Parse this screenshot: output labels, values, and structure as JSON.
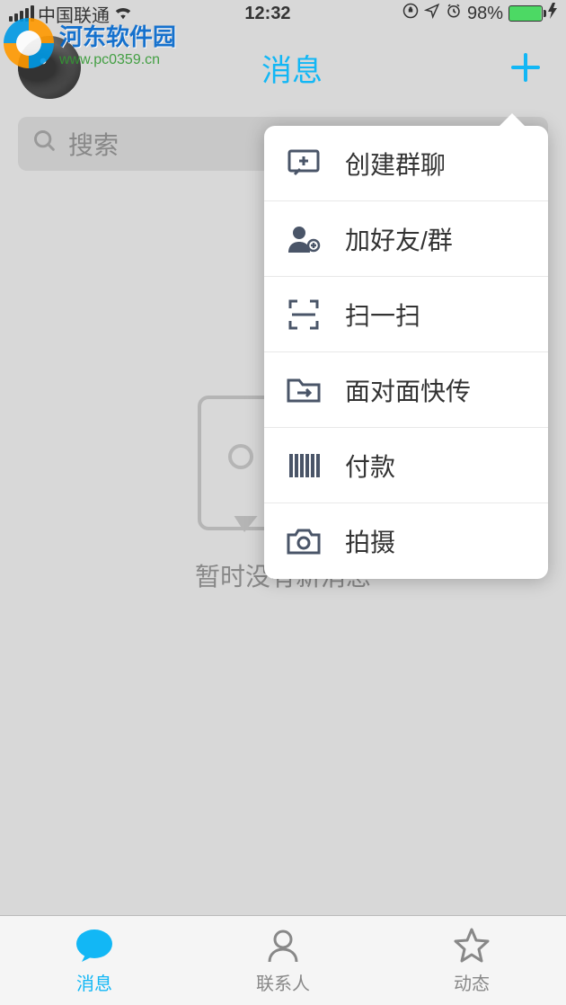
{
  "status": {
    "carrier": "中国联通",
    "time": "12:32",
    "battery_pct": "98%"
  },
  "header": {
    "title": "消息"
  },
  "search": {
    "placeholder": "搜索"
  },
  "empty": {
    "text": "暂时没有新消息"
  },
  "dropdown": {
    "items": [
      {
        "label": "创建群聊",
        "icon": "create-group-icon"
      },
      {
        "label": "加好友/群",
        "icon": "add-friend-icon"
      },
      {
        "label": "扫一扫",
        "icon": "scan-icon"
      },
      {
        "label": "面对面快传",
        "icon": "transfer-icon"
      },
      {
        "label": "付款",
        "icon": "payment-icon"
      },
      {
        "label": "拍摄",
        "icon": "camera-icon"
      }
    ]
  },
  "tabs": [
    {
      "label": "消息",
      "icon": "messages-tab-icon",
      "active": true
    },
    {
      "label": "联系人",
      "icon": "contacts-tab-icon",
      "active": false
    },
    {
      "label": "动态",
      "icon": "moments-tab-icon",
      "active": false
    }
  ],
  "watermark": {
    "title": "河东软件园",
    "url": "www.pc0359.cn"
  }
}
